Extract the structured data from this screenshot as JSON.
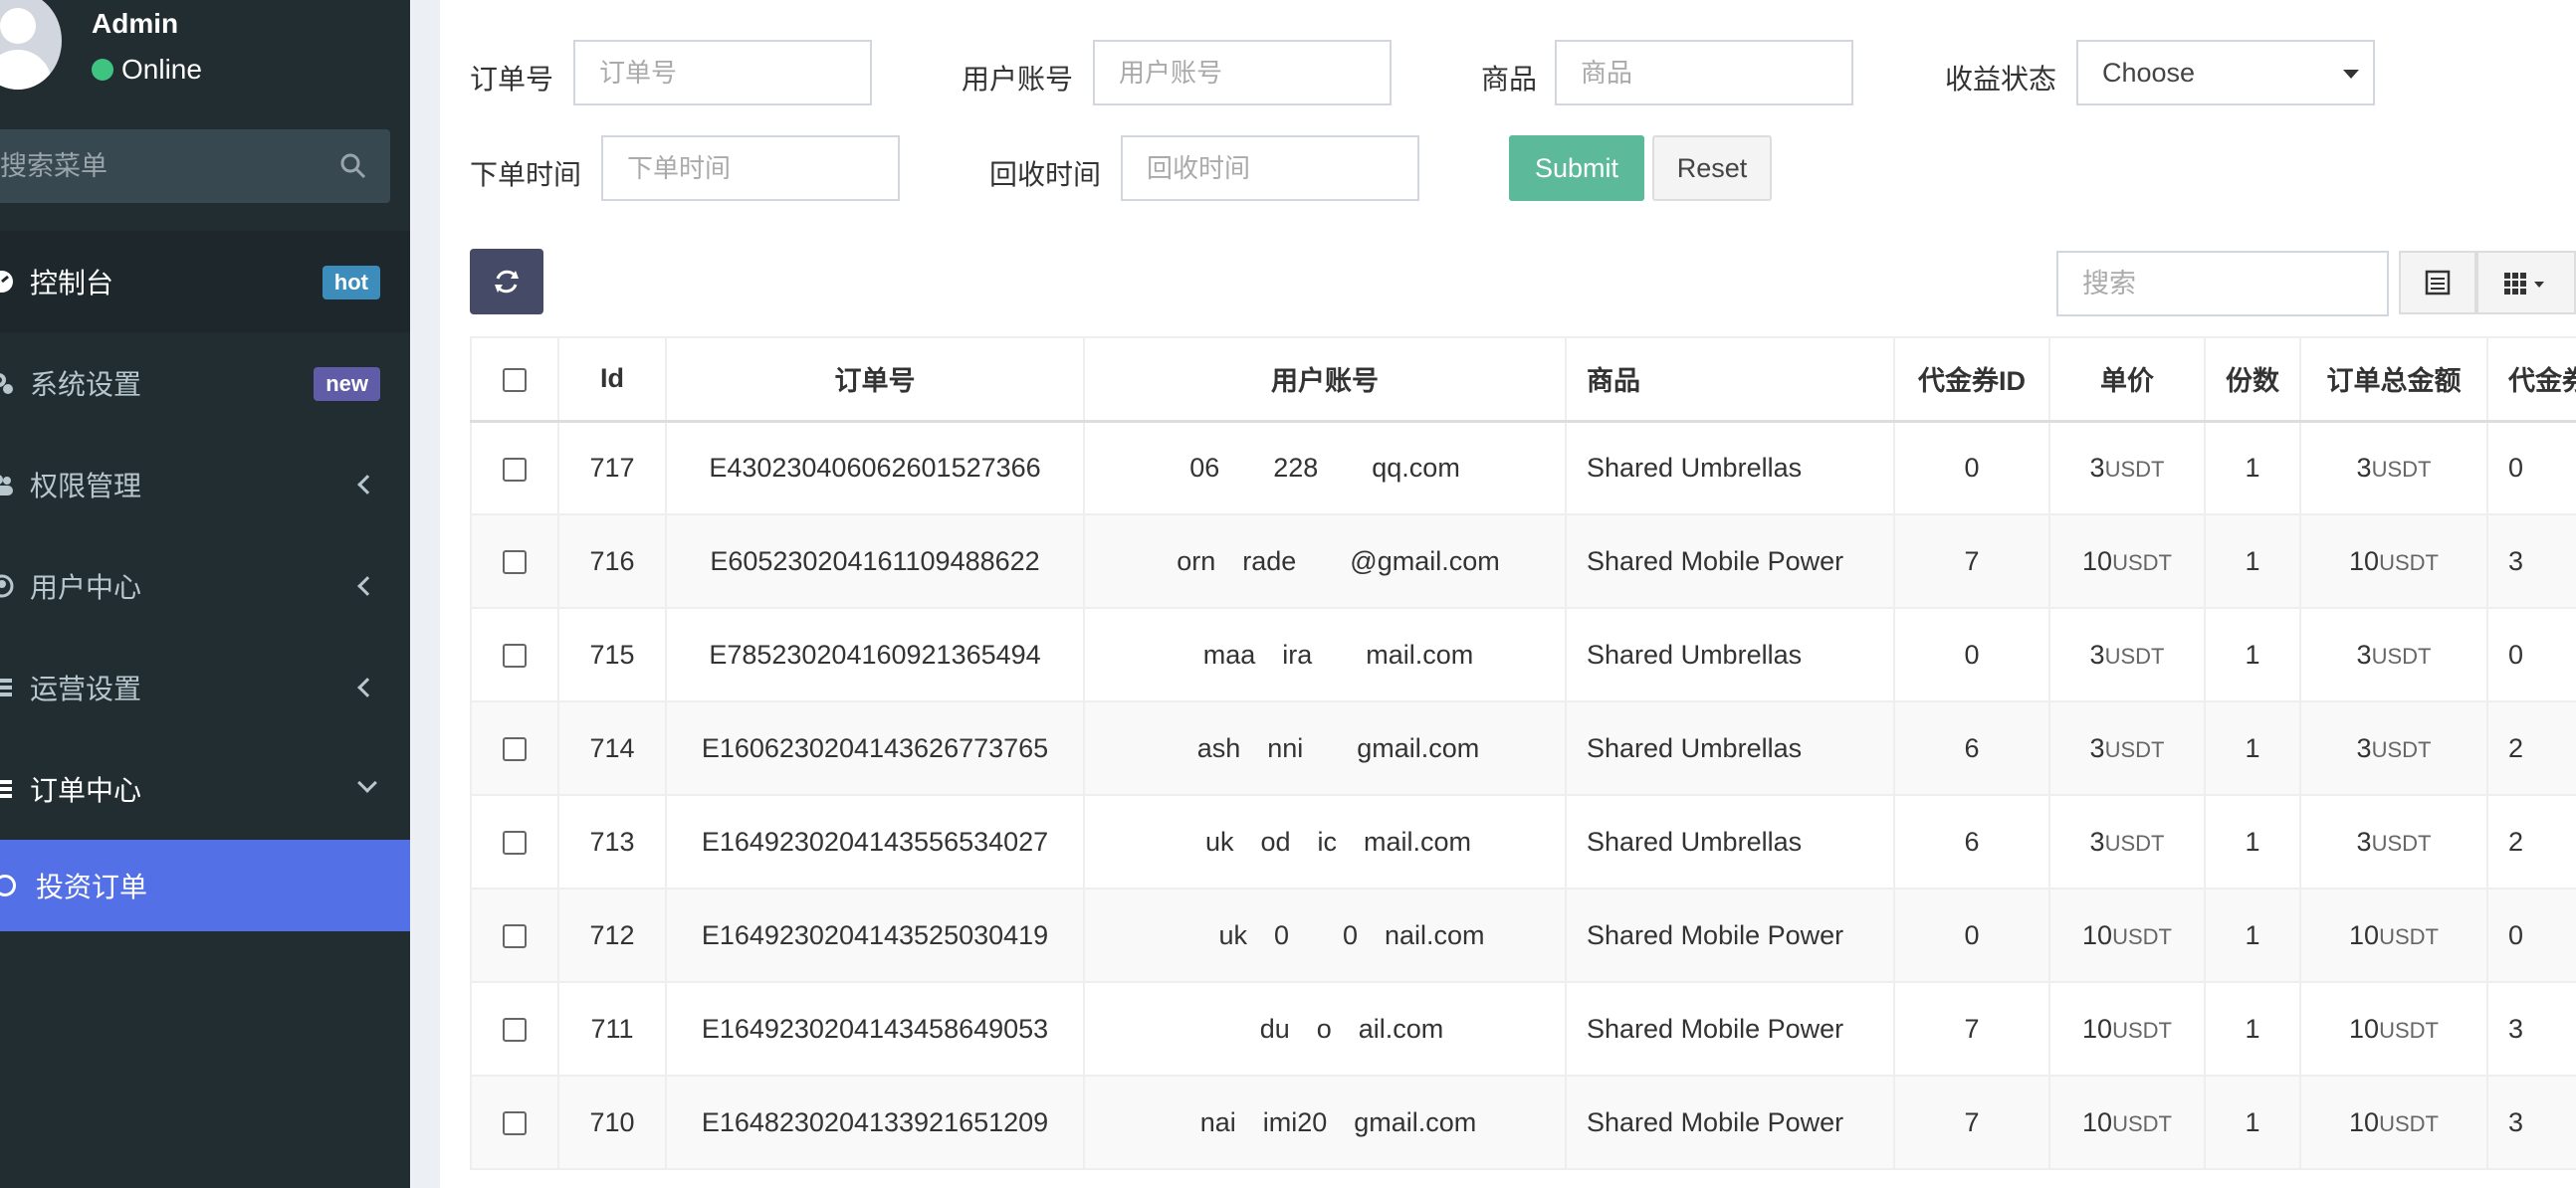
{
  "sidebar": {
    "user": {
      "name": "Admin",
      "status": "Online"
    },
    "search_placeholder": "搜索菜单",
    "menu": [
      {
        "label": "控制台",
        "icon": "dashboard-icon",
        "badge": "hot"
      },
      {
        "label": "系统设置",
        "icon": "gears-icon",
        "badge": "new"
      },
      {
        "label": "权限管理",
        "icon": "users-icon"
      },
      {
        "label": "用户中心",
        "icon": "user-circle-icon"
      },
      {
        "label": "运营设置",
        "icon": "list-icon"
      },
      {
        "label": "订单中心",
        "icon": "list-icon"
      }
    ],
    "submenu": [
      {
        "label": "投资订单",
        "icon": "circle-icon"
      }
    ]
  },
  "filters": {
    "order_no": {
      "label": "订单号",
      "placeholder": "订单号"
    },
    "user_account": {
      "label": "用户账号",
      "placeholder": "用户账号"
    },
    "product": {
      "label": "商品",
      "placeholder": "商品"
    },
    "profit_status": {
      "label": "收益状态",
      "value": "Choose"
    },
    "order_time": {
      "label": "下单时间",
      "placeholder": "下单时间"
    },
    "recycle_time": {
      "label": "回收时间",
      "placeholder": "回收时间"
    },
    "submit": "Submit",
    "reset": "Reset"
  },
  "toolbar": {
    "search_placeholder": "搜索"
  },
  "table": {
    "columns": [
      "Id",
      "订单号",
      "用户账号",
      "商品",
      "代金券ID",
      "单价",
      "份数",
      "订单总金额",
      "代金券"
    ],
    "unit": "USDT",
    "rows": [
      {
        "id": "717",
        "order_no": "E430230406062601527366",
        "user": "06  228  qq.com",
        "product": "Shared Umbrellas",
        "coupon_id": "0",
        "price": "3",
        "qty": "1",
        "total": "3",
        "coupon": "0"
      },
      {
        "id": "716",
        "order_no": "E605230204161109488622",
        "user": " orn rade  @gmail.com",
        "product": "Shared Mobile Power",
        "coupon_id": "7",
        "price": "10",
        "qty": "1",
        "total": "10",
        "coupon": "3"
      },
      {
        "id": "715",
        "order_no": "E785230204160921365494",
        "user": " maa ira  mail.com",
        "product": "Shared Umbrellas",
        "coupon_id": "0",
        "price": "3",
        "qty": "1",
        "total": "3",
        "coupon": "0"
      },
      {
        "id": "714",
        "order_no": "E160623020414362677376​5",
        "user": " ash nni  gmail.com",
        "product": "Shared Umbrellas",
        "coupon_id": "6",
        "price": "3",
        "qty": "1",
        "total": "3",
        "coupon": "2"
      },
      {
        "id": "713",
        "order_no": "E164923020414355653402​7",
        "user": " uk od ic mail.com",
        "product": "Shared Umbrellas",
        "coupon_id": "6",
        "price": "3",
        "qty": "1",
        "total": "3",
        "coupon": "2"
      },
      {
        "id": "712",
        "order_no": "E164923020414352503041​9",
        "user": "  uk 0  0 nail.com",
        "product": "Shared Mobile Power",
        "coupon_id": "0",
        "price": "10",
        "qty": "1",
        "total": "10",
        "coupon": "0"
      },
      {
        "id": "711",
        "order_no": "E164923020414345864905​3",
        "user": "  du o ail.com",
        "product": "Shared Mobile Power",
        "coupon_id": "7",
        "price": "10",
        "qty": "1",
        "total": "10",
        "coupon": "3"
      },
      {
        "id": "710",
        "order_no": "E164823020413392165120​9",
        "user": " nai imi20 gmail.com",
        "product": "Shared Mobile Power",
        "coupon_id": "7",
        "price": "10",
        "qty": "1",
        "total": "10",
        "coupon": "3"
      }
    ]
  }
}
